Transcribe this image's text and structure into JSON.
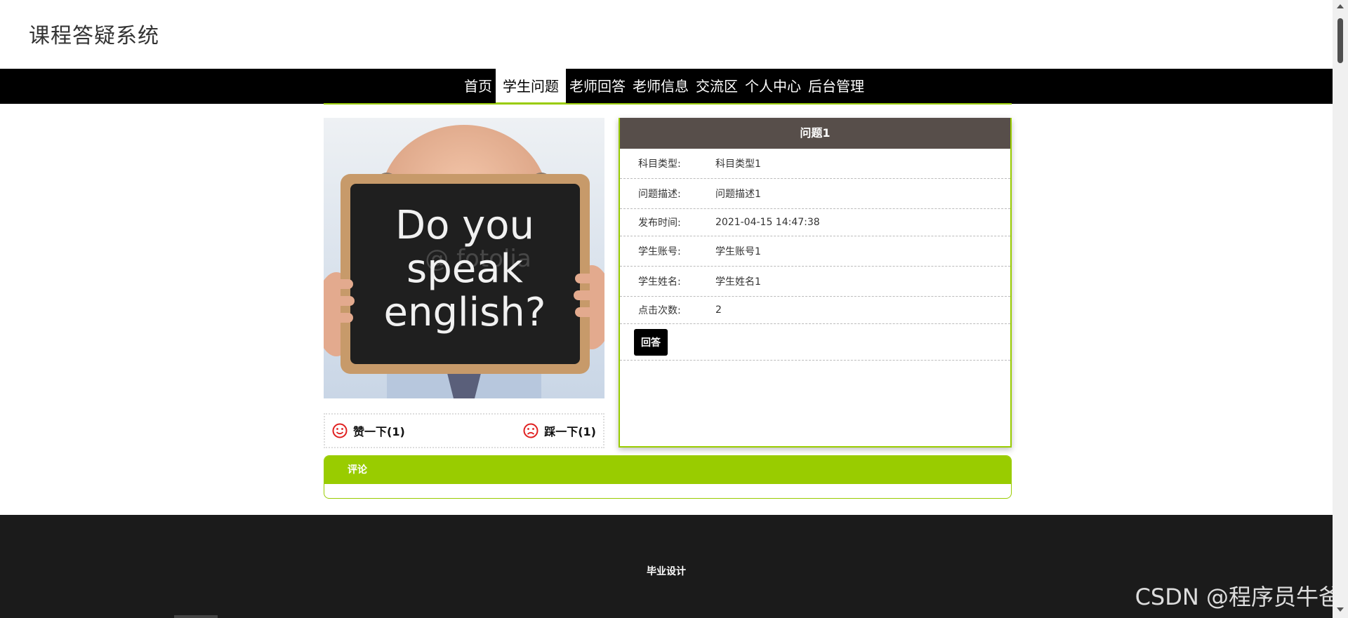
{
  "header": {
    "site_title": "课程答疑系统"
  },
  "nav": {
    "items": [
      {
        "label": "首页",
        "active": false
      },
      {
        "label": "学生问题",
        "active": true
      },
      {
        "label": "老师回答",
        "active": false
      },
      {
        "label": "老师信息",
        "active": false
      },
      {
        "label": "交流区",
        "active": false
      },
      {
        "label": "个人中心",
        "active": false
      },
      {
        "label": "后台管理",
        "active": false
      }
    ]
  },
  "image": {
    "board_line1": "Do you",
    "board_line2": "speak",
    "board_line3": "english?",
    "board_watermark": "@ fotolia"
  },
  "votes": {
    "up_label": "赞一下(1)",
    "down_label": "踩一下(1)",
    "up_icon": "smile-icon",
    "down_icon": "frown-icon"
  },
  "detail": {
    "title": "问题1",
    "rows": [
      {
        "label": "科目类型:",
        "value": "科目类型1"
      },
      {
        "label": "问题描述:",
        "value": "问题描述1"
      },
      {
        "label": "发布时间:",
        "value": "2021-04-15 14:47:38"
      },
      {
        "label": "学生账号:",
        "value": "学生账号1"
      },
      {
        "label": "学生姓名:",
        "value": "学生姓名1"
      },
      {
        "label": "点击次数:",
        "value": "2"
      }
    ],
    "answer_button": "回答"
  },
  "comments": {
    "title": "评论"
  },
  "footer": {
    "text": "毕业设计"
  },
  "watermark": "CSDN @程序员牛爸",
  "colors": {
    "accent": "#99cc00",
    "nav_bg": "#000000",
    "title_bar": "#574e4a",
    "footer_bg": "#1b1b1b",
    "icon_red": "#e02020"
  }
}
